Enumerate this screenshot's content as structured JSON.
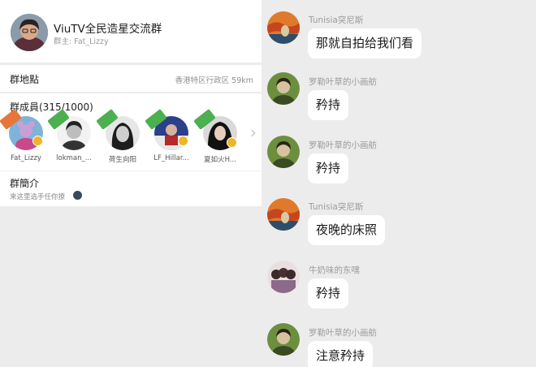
{
  "group": {
    "name": "ViuTV全民造星交流群",
    "owner_label": "群主: Fat_Lizzy"
  },
  "location": {
    "label": "群地點",
    "value": "香港特区行政区 59km"
  },
  "members": {
    "label": "群成員(315/1000)",
    "list": [
      {
        "name": "Fat_Lizzy",
        "ribbon": "群主"
      },
      {
        "name": "lokman_..."
      },
      {
        "name": "荷生向阳"
      },
      {
        "name": "LF_Hillar..."
      },
      {
        "name": "夏如火H..."
      }
    ]
  },
  "intro": {
    "label": "群簡介",
    "text": "来这里选手任你撩"
  },
  "messages": [
    {
      "sender": "Tunisia突尼斯",
      "text": "那就自拍给我们看",
      "avatar_icon": "scream-painting-avatar"
    },
    {
      "sender": "罗勒叶草的小画舫",
      "text": "矜持",
      "avatar_icon": "woman-green-avatar"
    },
    {
      "sender": "罗勒叶草的小画舫",
      "text": "矜持",
      "avatar_icon": "woman-green-avatar"
    },
    {
      "sender": "Tunisia突尼斯",
      "text": "夜晚的床照",
      "avatar_icon": "scream-painting-avatar"
    },
    {
      "sender": "牛奶味的东嘿",
      "text": "矜持",
      "avatar_icon": "group-photo-avatar"
    },
    {
      "sender": "罗勒叶草的小画舫",
      "text": "注意矜持",
      "avatar_icon": "woman-green-avatar"
    }
  ],
  "colors": {
    "background": "#e9e9e9",
    "card": "#ffffff",
    "owner_ribbon": "#e8753a",
    "member_ribbon": "#4caf50",
    "vip_badge": "#f0b429"
  }
}
